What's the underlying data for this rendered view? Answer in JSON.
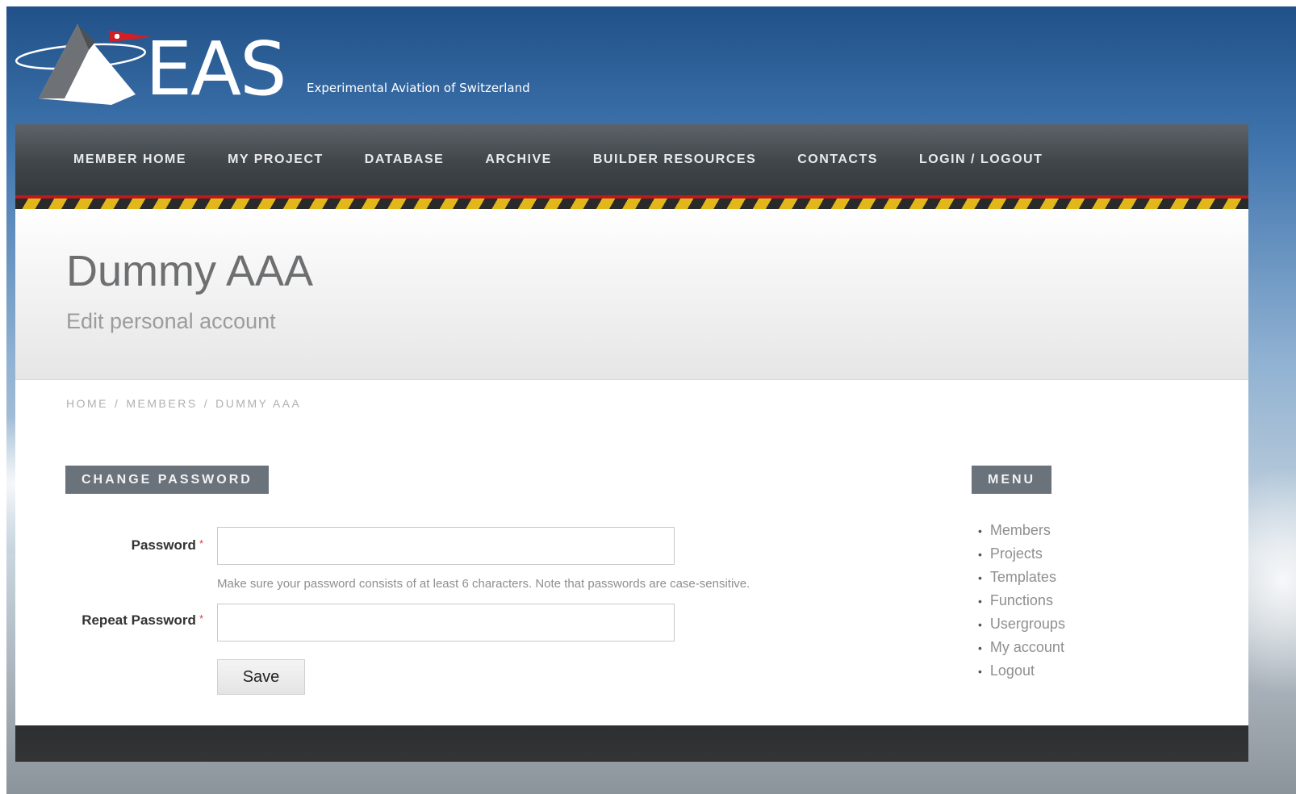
{
  "header": {
    "logo_text": "EAS",
    "logo_tagline": "Experimental Aviation of Switzerland"
  },
  "nav": {
    "items": [
      {
        "label": "MEMBER HOME"
      },
      {
        "label": "MY PROJECT"
      },
      {
        "label": "DATABASE"
      },
      {
        "label": "ARCHIVE"
      },
      {
        "label": "BUILDER RESOURCES"
      },
      {
        "label": "CONTACTS"
      },
      {
        "label": "LOGIN / LOGOUT"
      }
    ]
  },
  "page": {
    "title": "Dummy AAA",
    "subtitle": "Edit personal account"
  },
  "breadcrumb": {
    "items": [
      "HOME",
      "MEMBERS",
      "DUMMY AAA"
    ],
    "separator": "/"
  },
  "form": {
    "heading": "CHANGE PASSWORD",
    "password_label": "Password",
    "password_value": "",
    "hint": "Make sure your password consists of at least 6 characters. Note that passwords are case-sensitive.",
    "repeat_label": "Repeat Password",
    "repeat_value": "",
    "required_marker": "*",
    "save_label": "Save"
  },
  "menu": {
    "heading": "MENU",
    "bullet": "•",
    "items": [
      "Members",
      "Projects",
      "Templates",
      "Functions",
      "Usergroups",
      "My account",
      "Logout"
    ]
  },
  "colors": {
    "nav_bg": "#3f4549",
    "hazard_yellow": "#e2b71b",
    "accent_red": "#c0181b",
    "heading_bg": "#6a737b"
  }
}
